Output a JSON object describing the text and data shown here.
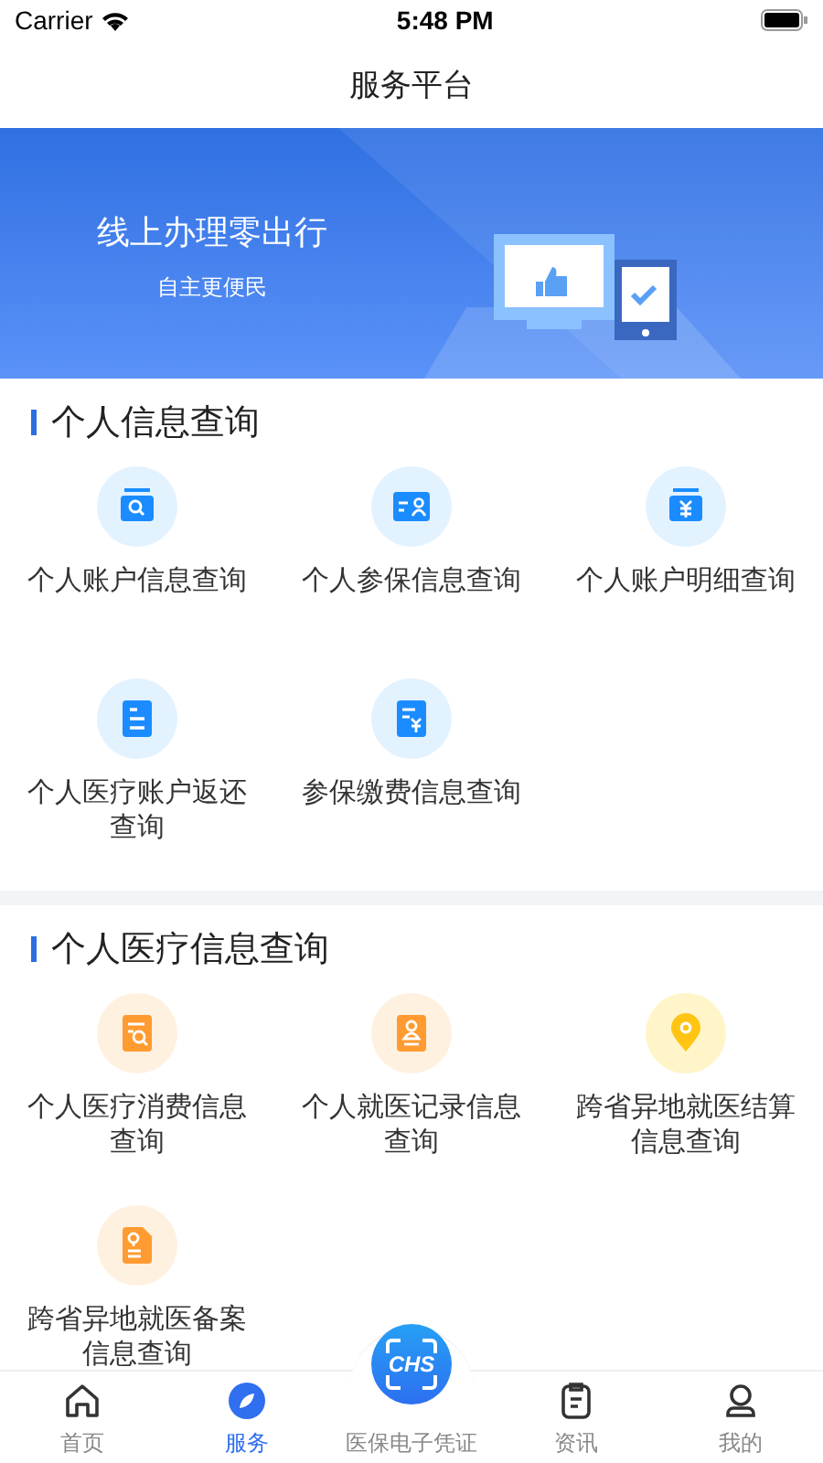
{
  "status_bar": {
    "carrier": "Carrier",
    "time": "5:48 PM"
  },
  "nav": {
    "title": "服务平台"
  },
  "banner": {
    "headline": "线上办理零出行",
    "subline": "自主更便民"
  },
  "sections": [
    {
      "title": "个人信息查询",
      "items": [
        {
          "label": "个人账户信息查询",
          "color": "#1a8cff"
        },
        {
          "label": "个人参保信息查询",
          "color": "#1a8cff"
        },
        {
          "label": "个人账户明细查询",
          "color": "#1a8cff"
        },
        {
          "label": "个人医疗账户返还查询",
          "color": "#1a8cff"
        },
        {
          "label": "参保缴费信息查询",
          "color": "#1a8cff"
        }
      ]
    },
    {
      "title": "个人医疗信息查询",
      "items": [
        {
          "label": "个人医疗消费信息查询",
          "color": "#ff9b30"
        },
        {
          "label": "个人就医记录信息查询",
          "color": "#ff9b30"
        },
        {
          "label": "跨省异地就医结算信息查询",
          "color": "#ffc414"
        },
        {
          "label": "跨省异地就医备案信息查询",
          "color": "#ff9b30"
        }
      ]
    }
  ],
  "tabs": [
    {
      "label": "首页",
      "selected": false,
      "kind": "tab"
    },
    {
      "label": "服务",
      "selected": true,
      "kind": "tab"
    },
    {
      "label": "医保电子凭证",
      "selected": false,
      "kind": "scan",
      "badge": "CHS"
    },
    {
      "label": "资讯",
      "selected": false,
      "kind": "tab"
    },
    {
      "label": "我的",
      "selected": false,
      "kind": "tab"
    }
  ]
}
